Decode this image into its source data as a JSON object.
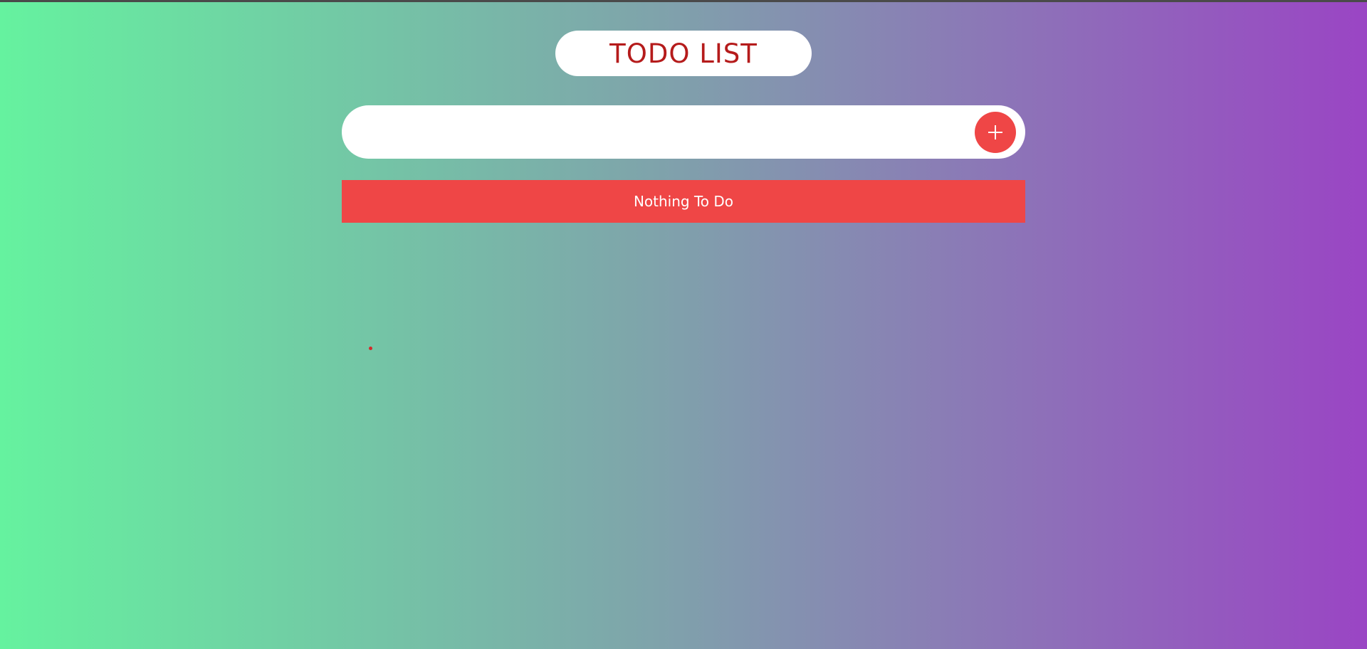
{
  "app": {
    "title": "TODO LIST"
  },
  "input": {
    "value": "",
    "placeholder": "",
    "add_button_icon": "plus-icon"
  },
  "list": {
    "empty_message": "Nothing To Do",
    "items": []
  },
  "colors": {
    "accent": "#ef4646",
    "title_text": "#b51b1b",
    "gradient_start": "#65f29f",
    "gradient_end": "#9a45c4"
  }
}
